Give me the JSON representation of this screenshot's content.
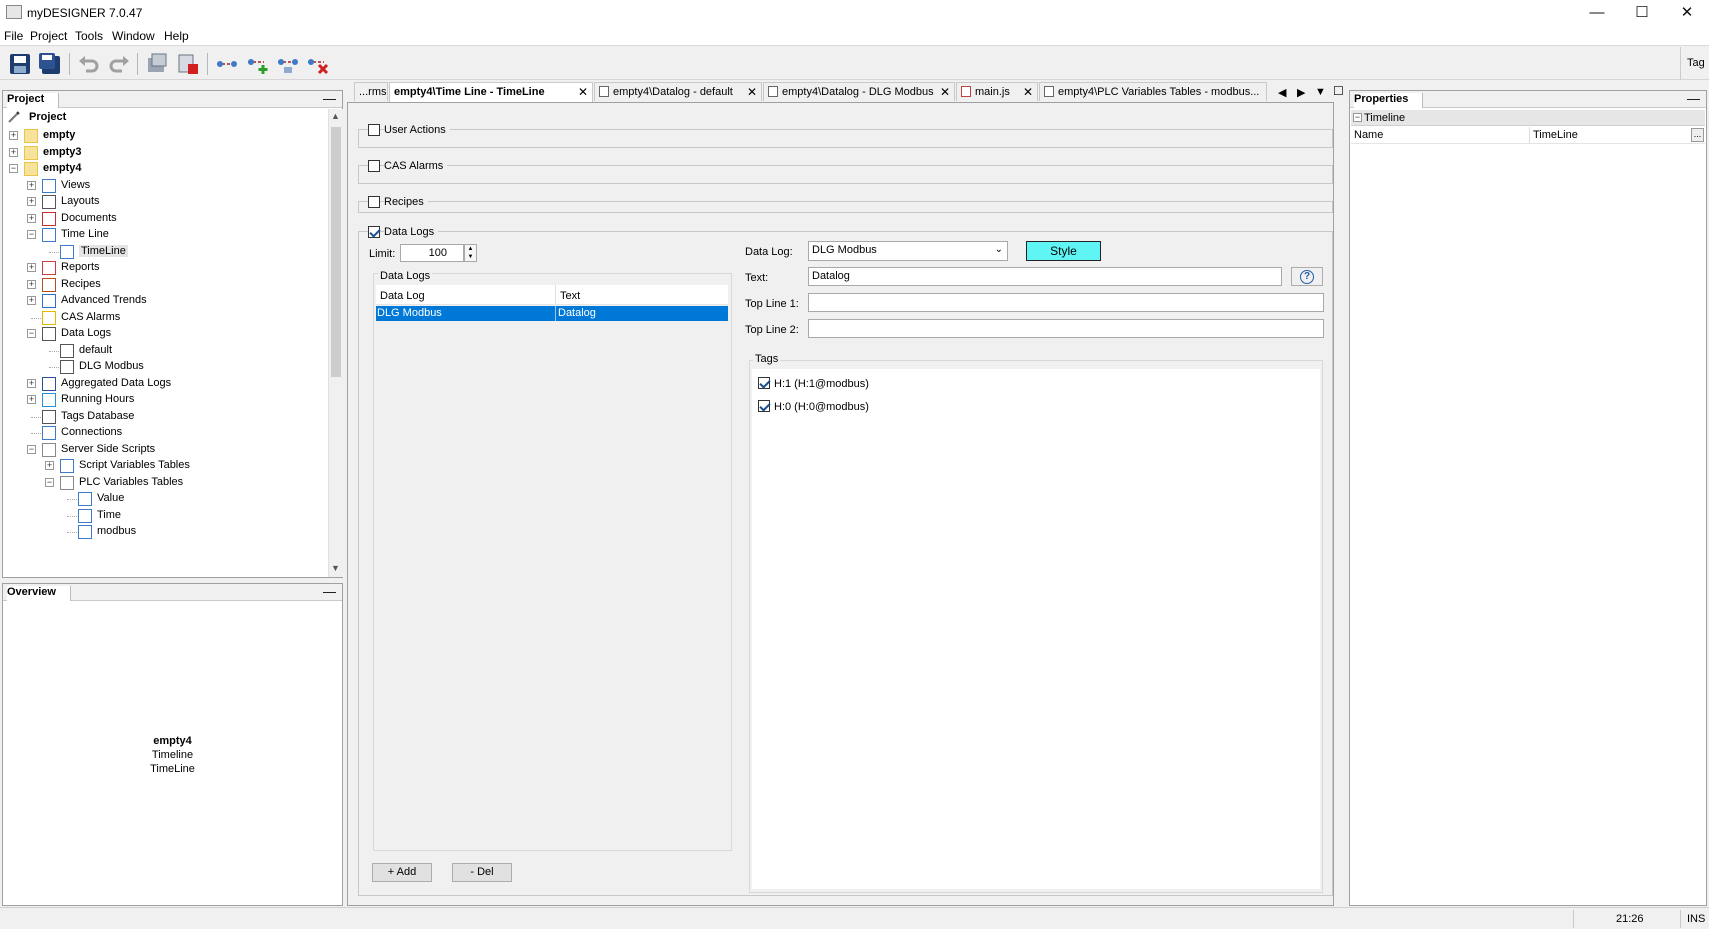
{
  "window": {
    "title": "myDESIGNER 7.0.47",
    "minimize": "—",
    "maximize": "☐",
    "close": "✕"
  },
  "menu": [
    "File",
    "Project",
    "Tools",
    "Window",
    "Help"
  ],
  "toolbar": {
    "right_label": "Tag"
  },
  "project_panel": {
    "title": "Project",
    "root": "Project",
    "nodes": [
      {
        "label": "empty",
        "bold": true,
        "level": 0
      },
      {
        "label": "empty3",
        "bold": true,
        "level": 0
      },
      {
        "label": "empty4",
        "bold": true,
        "level": 0
      },
      {
        "label": "Views",
        "level": 1
      },
      {
        "label": "Layouts",
        "level": 1
      },
      {
        "label": "Documents",
        "level": 1
      },
      {
        "label": "Time Line",
        "level": 1
      },
      {
        "label": "TimeLine",
        "level": 2
      },
      {
        "label": "Reports",
        "level": 1
      },
      {
        "label": "Recipes",
        "level": 1
      },
      {
        "label": "Advanced Trends",
        "level": 1
      },
      {
        "label": "CAS Alarms",
        "level": 1
      },
      {
        "label": "Data Logs",
        "level": 1
      },
      {
        "label": "default",
        "level": 2
      },
      {
        "label": "DLG Modbus",
        "level": 2
      },
      {
        "label": "Aggregated Data Logs",
        "level": 1
      },
      {
        "label": "Running Hours",
        "level": 1
      },
      {
        "label": "Tags Database",
        "level": 1
      },
      {
        "label": "Connections",
        "level": 1
      },
      {
        "label": "Server Side Scripts",
        "level": 1
      },
      {
        "label": "Script Variables Tables",
        "level": 2
      },
      {
        "label": "PLC Variables Tables",
        "level": 2
      },
      {
        "label": "Value",
        "level": 3
      },
      {
        "label": "Time",
        "level": 3
      },
      {
        "label": "modbus",
        "level": 3
      }
    ]
  },
  "overview_panel": {
    "title": "Overview",
    "line1": "empty4",
    "line2": "Timeline",
    "line3": "TimeLine"
  },
  "tabs": [
    {
      "label": "...rms",
      "active": false
    },
    {
      "label": "empty4\\Time Line - TimeLine",
      "active": true,
      "close": "✕"
    },
    {
      "label": "empty4\\Datalog - default",
      "active": false,
      "close": "✕"
    },
    {
      "label": "empty4\\Datalog - DLG Modbus",
      "active": false,
      "close": "✕"
    },
    {
      "label": "main.js",
      "active": false,
      "close": "✕"
    },
    {
      "label": "empty4\\PLC Variables Tables - modbus...",
      "active": false
    }
  ],
  "editor": {
    "user_actions": {
      "label": "User Actions",
      "checked": false
    },
    "cas_alarms": {
      "label": "CAS Alarms",
      "checked": false
    },
    "recipes": {
      "label": "Recipes",
      "checked": false
    },
    "data_logs": {
      "label": "Data Logs",
      "checked": true
    },
    "limit_label": "Limit:",
    "limit_value": "100",
    "datalogs_group_title": "Data Logs",
    "table_headers": [
      "Data Log",
      "Text"
    ],
    "table_rows": [
      [
        "DLG Modbus",
        "Datalog"
      ]
    ],
    "add_button": "+ Add",
    "del_button": "- Del",
    "datalog_label": "Data Log:",
    "datalog_value": "DLG Modbus",
    "style_button": "Style",
    "style_color": "#5ff5f5",
    "text_label": "Text:",
    "text_value": "Datalog",
    "help_icon": "?",
    "top_line1_label": "Top Line 1:",
    "top_line1_value": "",
    "top_line2_label": "Top Line 2:",
    "top_line2_value": "",
    "tags_title": "Tags",
    "tags": [
      {
        "label": "H:1  (H:1@modbus)",
        "checked": true
      },
      {
        "label": "H:0  (H:0@modbus)",
        "checked": true
      }
    ]
  },
  "properties_panel": {
    "title": "Properties",
    "section": "Timeline",
    "rows": [
      {
        "name": "Name",
        "value": "TimeLine",
        "button": "..."
      }
    ]
  },
  "statusbar": {
    "time": "21:26",
    "mode": "INS"
  },
  "colors": {
    "selection": "#0078d7",
    "style_button": "#5ff5f5"
  }
}
